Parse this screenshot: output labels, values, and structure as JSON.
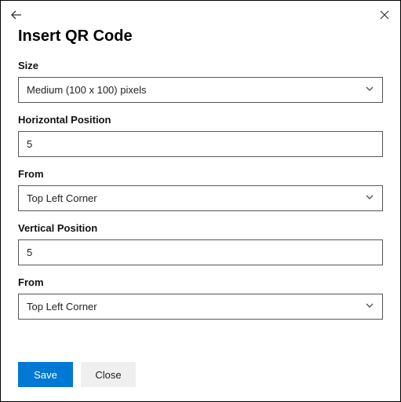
{
  "header": {
    "title": "Insert QR Code"
  },
  "fields": {
    "size": {
      "label": "Size",
      "value": "Medium (100 x 100) pixels"
    },
    "hpos": {
      "label": "Horizontal Position",
      "value": "5"
    },
    "hfrom": {
      "label": "From",
      "value": "Top Left Corner"
    },
    "vpos": {
      "label": "Vertical Position",
      "value": "5"
    },
    "vfrom": {
      "label": "From",
      "value": "Top Left Corner"
    }
  },
  "footer": {
    "save": "Save",
    "close": "Close"
  }
}
